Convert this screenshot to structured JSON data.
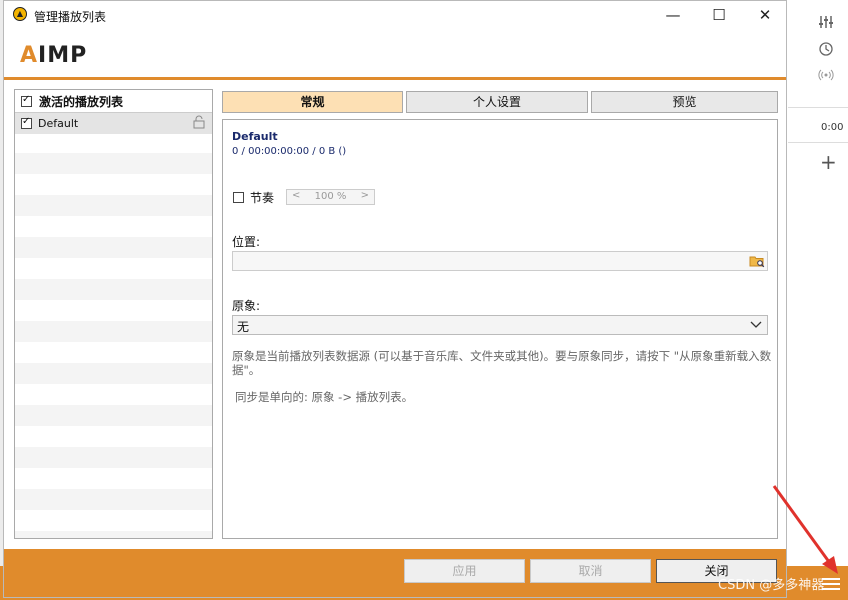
{
  "window": {
    "title": "管理播放列表",
    "minimize": "—",
    "maximize": "☐",
    "close": "✕"
  },
  "logo": {
    "prefix": "A",
    "rest": "IMP"
  },
  "playlists": {
    "header": "激活的播放列表",
    "items": [
      {
        "label": "Default",
        "checked": true,
        "locked": false
      }
    ]
  },
  "tabs": [
    {
      "label": "常规",
      "active": true
    },
    {
      "label": "个人设置",
      "active": false
    },
    {
      "label": "预览",
      "active": false
    }
  ],
  "general": {
    "playlist_name": "Default",
    "stats": "0 / 00:00:00:00 / 0 B ()",
    "rhythm_label": "节奏",
    "rhythm_checked": false,
    "rhythm_value": "100 %",
    "location_label": "位置:",
    "location_value": "",
    "source_label": "原象:",
    "source_value": "无",
    "source_description": "原象是当前播放列表数据源 (可以基于音乐库、文件夹或其他)。要与原象同步，请按下 \"从原象重新载入数据\"。",
    "sync_note": "同步是单向的: 原象 -> 播放列表。"
  },
  "buttons": {
    "apply": "应用",
    "cancel": "取消",
    "close": "关闭"
  },
  "background_app": {
    "time": "0:00",
    "add": "+"
  },
  "watermark": "CSDN @多多神器",
  "colors": {
    "accent": "#e08b2c",
    "active_tab": "#fde0b4",
    "link_text": "#1a2a6c"
  }
}
